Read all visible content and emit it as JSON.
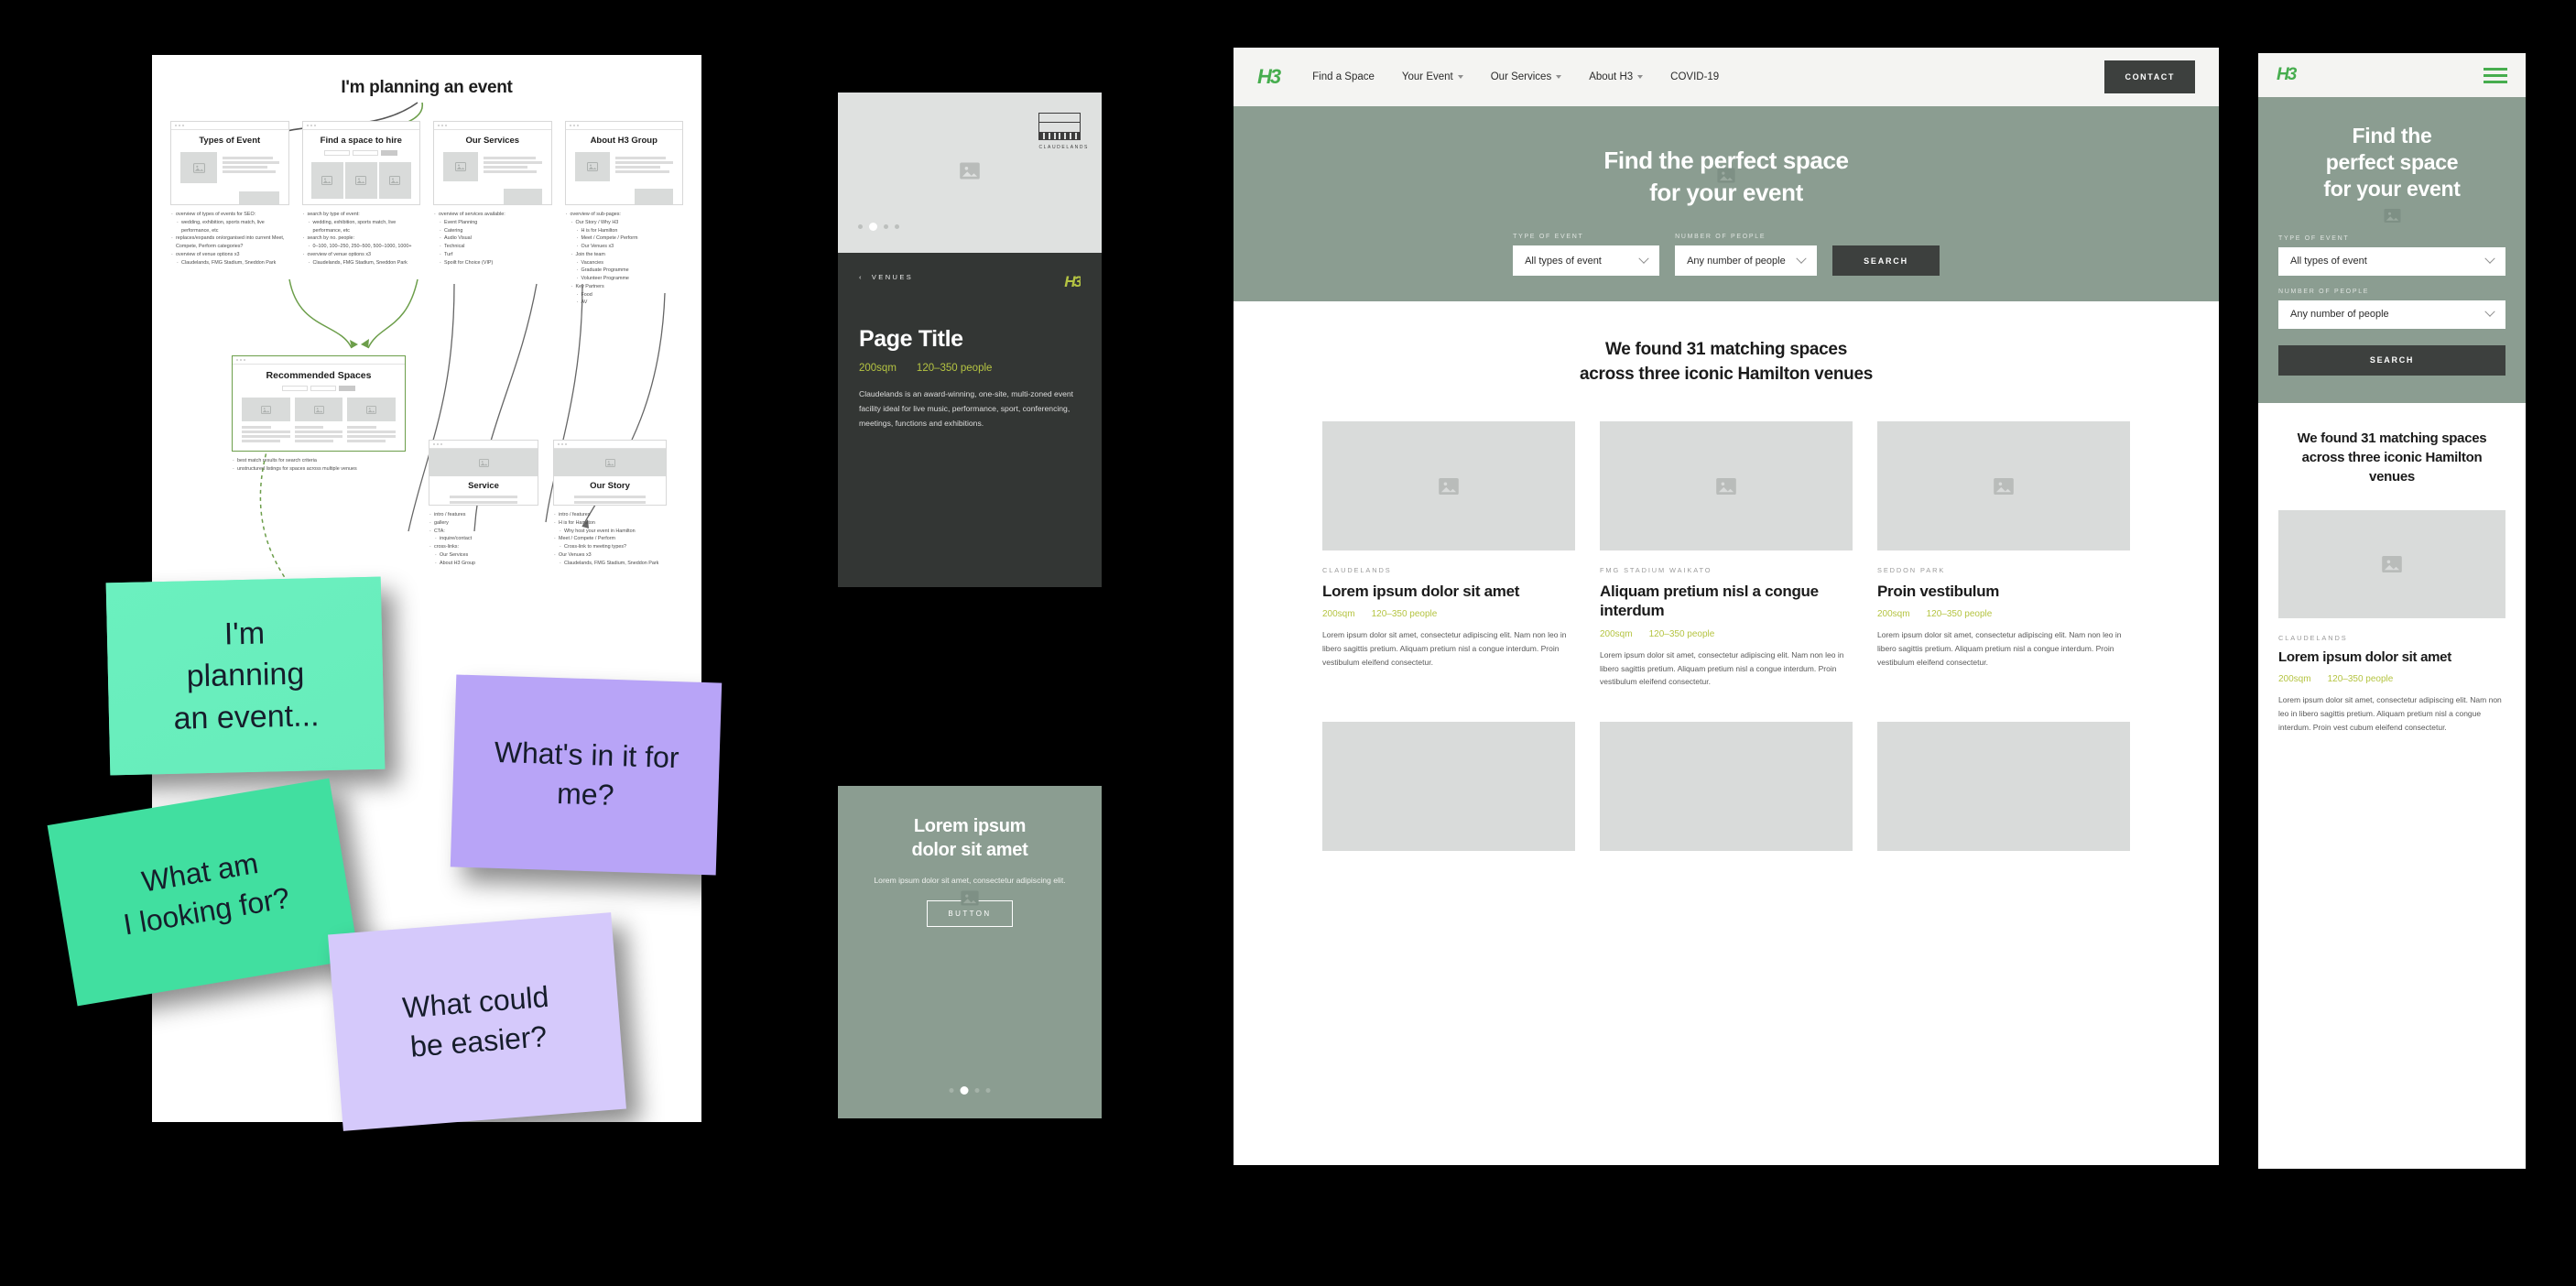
{
  "sitemap": {
    "title": "I'm planning an event",
    "columns": [
      {
        "heading": "Types of Event",
        "notes": [
          "overview of types of events for SEO:",
          "wedding, exhibition, sports match, live performance, etc",
          "replaces/expands on/organised into current Meet, Compete, Perform categories?",
          "overview of venue options x3",
          "Claudelands, FMG Stadium, Sneddon Park"
        ]
      },
      {
        "heading": "Find a space to hire",
        "notes": [
          "search by type of event:",
          "wedding, exhibition, sports match, live performance, etc",
          "search by no. people:",
          "0–100, 100–250, 250–500, 500–1000, 1000+",
          "overview of venue options x3",
          "Claudelands, FMG Stadium, Sneddon Park"
        ]
      },
      {
        "heading": "Our Services",
        "notes": [
          "overview of services available:",
          "Event Planning",
          "Catering",
          "Audio Visual",
          "Technical",
          "Turf",
          "Spoilt for Choice (VIP)"
        ]
      },
      {
        "heading": "About H3 Group",
        "notes": [
          "overview of sub-pages:",
          "Our Story / Why H3",
          "H is for Hamilton",
          "Meet / Compete / Perform",
          "Our Venues x3",
          "Join the team",
          "Vacancies",
          "Graduate Programme",
          "Volunteer Programme",
          "Key Partners",
          "Food",
          "AV"
        ]
      }
    ],
    "recommended": {
      "heading": "Recommended Spaces",
      "notes": [
        "best match results for search criteria",
        "unstructured listings for spaces across multiple venues"
      ]
    },
    "lower": [
      {
        "heading": "Service",
        "notes": [
          "intro / features",
          "gallery",
          "CTA:",
          "inquire/contact",
          "cross-links:",
          "Our Services",
          "About H3 Group"
        ]
      },
      {
        "heading": "Our Story",
        "notes": [
          "intro / features",
          "H is for Hamilton",
          "Why host your event in Hamilton",
          "Meet / Compete / Perform",
          "Cross-link to meeting types?",
          "Our Venues x3",
          "Claudelands, FMG Stadium, Sneddon Park"
        ]
      }
    ]
  },
  "stickies": [
    {
      "id": "planning",
      "text": "I'm\nplanning\nan event...",
      "color": "#6ff0c0"
    },
    {
      "id": "looking",
      "text": "What am\nI looking for?",
      "color": "#41dfa0"
    },
    {
      "id": "whatsinit",
      "text": "What's in it for\nme?",
      "color": "#b8a4f7"
    },
    {
      "id": "easier",
      "text": "What could\nbe easier?",
      "color": "#d5c9fb"
    }
  ],
  "venue_card": {
    "logo_caption": "CLAUDELANDS",
    "breadcrumb": "VENUES",
    "brand": "H3",
    "title": "Page Title",
    "area": "200sqm",
    "capacity": "120–350 people",
    "description": "Claudelands is an award-winning, one-site, multi-zoned event facility ideal for live music, performance, sport, conferencing, meetings, functions and exhibitions.",
    "carousel_dots": 4,
    "carousel_active": 1
  },
  "promo_card": {
    "title": "Lorem ipsum\ndolor sit amet",
    "subtitle": "Lorem ipsum dolor sit amet, consectetur adipiscing elit.",
    "button": "BUTTON",
    "carousel_dots": 4,
    "carousel_active": 1
  },
  "desktop": {
    "brand": "H3",
    "nav": [
      {
        "label": "Find a Space",
        "has_caret": false
      },
      {
        "label": "Your Event",
        "has_caret": true
      },
      {
        "label": "Our Services",
        "has_caret": true
      },
      {
        "label": "About H3",
        "has_caret": true
      },
      {
        "label": "COVID-19",
        "has_caret": false
      }
    ],
    "contact_button": "CONTACT",
    "hero": {
      "title": "Find the perfect space\nfor your event",
      "event_label": "TYPE OF EVENT",
      "event_value": "All types of event",
      "people_label": "NUMBER OF PEOPLE",
      "people_value": "Any number of people",
      "search_button": "SEARCH"
    },
    "results_title": "We found 31 matching spaces\nacross three iconic Hamilton venues",
    "cards": [
      {
        "venue": "CLAUDELANDS",
        "title": "Lorem ipsum dolor sit amet",
        "area": "200sqm",
        "capacity": "120–350 people",
        "desc": "Lorem ipsum dolor sit amet, consectetur adipiscing elit. Nam non leo in libero sagittis pretium. Aliquam pretium nisl a congue interdum. Proin vestibulum eleifend consectetur."
      },
      {
        "venue": "FMG STADIUM WAIKATO",
        "title": "Aliquam pretium nisl a congue interdum",
        "area": "200sqm",
        "capacity": "120–350 people",
        "desc": "Lorem ipsum dolor sit amet, consectetur adipiscing elit. Nam non leo in libero sagittis pretium. Aliquam pretium nisl a congue interdum. Proin vestibulum eleifend consectetur."
      },
      {
        "venue": "SEDDON PARK",
        "title": "Proin vestibulum",
        "area": "200sqm",
        "capacity": "120–350 people",
        "desc": "Lorem ipsum dolor sit amet, consectetur adipiscing elit. Nam non leo in libero sagittis pretium. Aliquam pretium nisl a congue interdum. Proin vestibulum eleifend consectetur."
      }
    ]
  },
  "mobile": {
    "brand": "H3",
    "hero": {
      "title": "Find the\nperfect space\nfor your event",
      "event_label": "TYPE OF EVENT",
      "event_value": "All types of event",
      "people_label": "NUMBER OF PEOPLE",
      "people_value": "Any number of people",
      "search_button": "SEARCH"
    },
    "results_title": "We found 31 matching spaces across three iconic Hamilton venues",
    "card": {
      "venue": "CLAUDELANDS",
      "title": "Lorem ipsum dolor sit amet",
      "area": "200sqm",
      "capacity": "120–350 people",
      "desc": "Lorem ipsum dolor sit amet, consectetur adipiscing elit. Nam non leo in libero sagittis pretium. Aliquam pretium nisl a congue interdum. Proin vest cubum eleifend consectetur."
    }
  },
  "colors": {
    "sage": "#8b9d91",
    "dark": "#3d403e",
    "lime": "#b5c442",
    "brand_green": "#46ad4e",
    "placeholder_grey": "#d9dbda"
  }
}
